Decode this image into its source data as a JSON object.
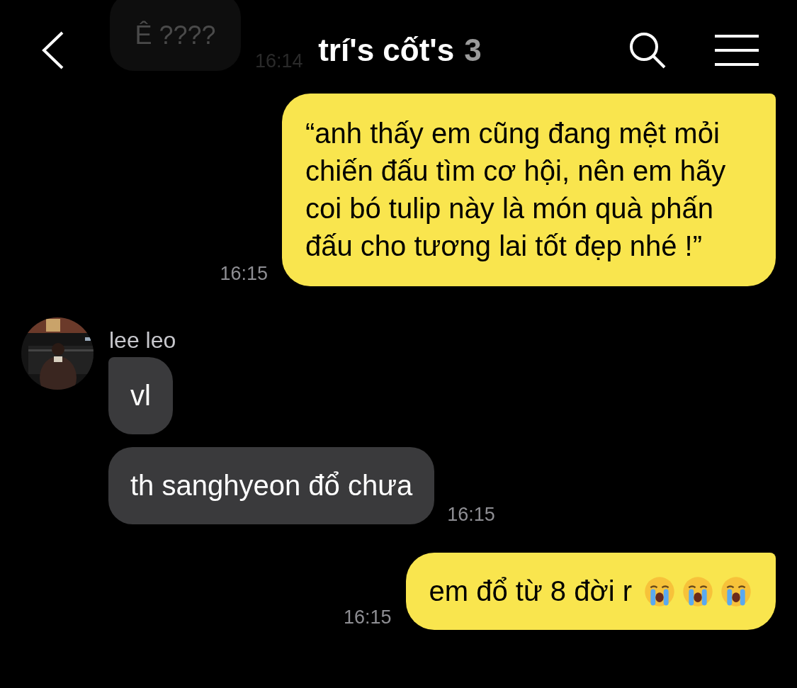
{
  "header": {
    "title": "trí's cốt's",
    "member_count": "3"
  },
  "messages": [
    {
      "kind": "faded",
      "text": "Ê ????",
      "time": "16:14"
    },
    {
      "kind": "mine",
      "text": "“anh thấy em cũng đang mệt mỏi chiến đấu tìm cơ hội, nên em hãy coi bó tulip này là món quà phấn đấu cho tương lai tốt đẹp nhé !”",
      "time": "16:15"
    },
    {
      "kind": "sender",
      "name": "lee leo"
    },
    {
      "kind": "theirs",
      "text": "vl"
    },
    {
      "kind": "theirs",
      "text": "th sanghyeon đổ chưa",
      "time": "16:15"
    },
    {
      "kind": "mine",
      "text": "em đổ từ 8 đời r",
      "emojis": [
        {
          "kind": "crying"
        },
        {
          "kind": "crying"
        },
        {
          "kind": "crying"
        }
      ],
      "time": "16:15"
    }
  ]
}
